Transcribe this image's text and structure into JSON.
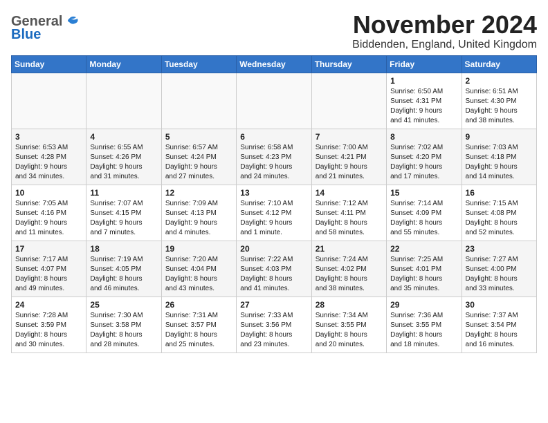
{
  "logo": {
    "general": "General",
    "blue": "Blue"
  },
  "header": {
    "month": "November 2024",
    "location": "Biddenden, England, United Kingdom"
  },
  "days_of_week": [
    "Sunday",
    "Monday",
    "Tuesday",
    "Wednesday",
    "Thursday",
    "Friday",
    "Saturday"
  ],
  "weeks": [
    [
      {
        "day": "",
        "info": ""
      },
      {
        "day": "",
        "info": ""
      },
      {
        "day": "",
        "info": ""
      },
      {
        "day": "",
        "info": ""
      },
      {
        "day": "",
        "info": ""
      },
      {
        "day": "1",
        "info": "Sunrise: 6:50 AM\nSunset: 4:31 PM\nDaylight: 9 hours\nand 41 minutes."
      },
      {
        "day": "2",
        "info": "Sunrise: 6:51 AM\nSunset: 4:30 PM\nDaylight: 9 hours\nand 38 minutes."
      }
    ],
    [
      {
        "day": "3",
        "info": "Sunrise: 6:53 AM\nSunset: 4:28 PM\nDaylight: 9 hours\nand 34 minutes."
      },
      {
        "day": "4",
        "info": "Sunrise: 6:55 AM\nSunset: 4:26 PM\nDaylight: 9 hours\nand 31 minutes."
      },
      {
        "day": "5",
        "info": "Sunrise: 6:57 AM\nSunset: 4:24 PM\nDaylight: 9 hours\nand 27 minutes."
      },
      {
        "day": "6",
        "info": "Sunrise: 6:58 AM\nSunset: 4:23 PM\nDaylight: 9 hours\nand 24 minutes."
      },
      {
        "day": "7",
        "info": "Sunrise: 7:00 AM\nSunset: 4:21 PM\nDaylight: 9 hours\nand 21 minutes."
      },
      {
        "day": "8",
        "info": "Sunrise: 7:02 AM\nSunset: 4:20 PM\nDaylight: 9 hours\nand 17 minutes."
      },
      {
        "day": "9",
        "info": "Sunrise: 7:03 AM\nSunset: 4:18 PM\nDaylight: 9 hours\nand 14 minutes."
      }
    ],
    [
      {
        "day": "10",
        "info": "Sunrise: 7:05 AM\nSunset: 4:16 PM\nDaylight: 9 hours\nand 11 minutes."
      },
      {
        "day": "11",
        "info": "Sunrise: 7:07 AM\nSunset: 4:15 PM\nDaylight: 9 hours\nand 7 minutes."
      },
      {
        "day": "12",
        "info": "Sunrise: 7:09 AM\nSunset: 4:13 PM\nDaylight: 9 hours\nand 4 minutes."
      },
      {
        "day": "13",
        "info": "Sunrise: 7:10 AM\nSunset: 4:12 PM\nDaylight: 9 hours\nand 1 minute."
      },
      {
        "day": "14",
        "info": "Sunrise: 7:12 AM\nSunset: 4:11 PM\nDaylight: 8 hours\nand 58 minutes."
      },
      {
        "day": "15",
        "info": "Sunrise: 7:14 AM\nSunset: 4:09 PM\nDaylight: 8 hours\nand 55 minutes."
      },
      {
        "day": "16",
        "info": "Sunrise: 7:15 AM\nSunset: 4:08 PM\nDaylight: 8 hours\nand 52 minutes."
      }
    ],
    [
      {
        "day": "17",
        "info": "Sunrise: 7:17 AM\nSunset: 4:07 PM\nDaylight: 8 hours\nand 49 minutes."
      },
      {
        "day": "18",
        "info": "Sunrise: 7:19 AM\nSunset: 4:05 PM\nDaylight: 8 hours\nand 46 minutes."
      },
      {
        "day": "19",
        "info": "Sunrise: 7:20 AM\nSunset: 4:04 PM\nDaylight: 8 hours\nand 43 minutes."
      },
      {
        "day": "20",
        "info": "Sunrise: 7:22 AM\nSunset: 4:03 PM\nDaylight: 8 hours\nand 41 minutes."
      },
      {
        "day": "21",
        "info": "Sunrise: 7:24 AM\nSunset: 4:02 PM\nDaylight: 8 hours\nand 38 minutes."
      },
      {
        "day": "22",
        "info": "Sunrise: 7:25 AM\nSunset: 4:01 PM\nDaylight: 8 hours\nand 35 minutes."
      },
      {
        "day": "23",
        "info": "Sunrise: 7:27 AM\nSunset: 4:00 PM\nDaylight: 8 hours\nand 33 minutes."
      }
    ],
    [
      {
        "day": "24",
        "info": "Sunrise: 7:28 AM\nSunset: 3:59 PM\nDaylight: 8 hours\nand 30 minutes."
      },
      {
        "day": "25",
        "info": "Sunrise: 7:30 AM\nSunset: 3:58 PM\nDaylight: 8 hours\nand 28 minutes."
      },
      {
        "day": "26",
        "info": "Sunrise: 7:31 AM\nSunset: 3:57 PM\nDaylight: 8 hours\nand 25 minutes."
      },
      {
        "day": "27",
        "info": "Sunrise: 7:33 AM\nSunset: 3:56 PM\nDaylight: 8 hours\nand 23 minutes."
      },
      {
        "day": "28",
        "info": "Sunrise: 7:34 AM\nSunset: 3:55 PM\nDaylight: 8 hours\nand 20 minutes."
      },
      {
        "day": "29",
        "info": "Sunrise: 7:36 AM\nSunset: 3:55 PM\nDaylight: 8 hours\nand 18 minutes."
      },
      {
        "day": "30",
        "info": "Sunrise: 7:37 AM\nSunset: 3:54 PM\nDaylight: 8 hours\nand 16 minutes."
      }
    ]
  ]
}
